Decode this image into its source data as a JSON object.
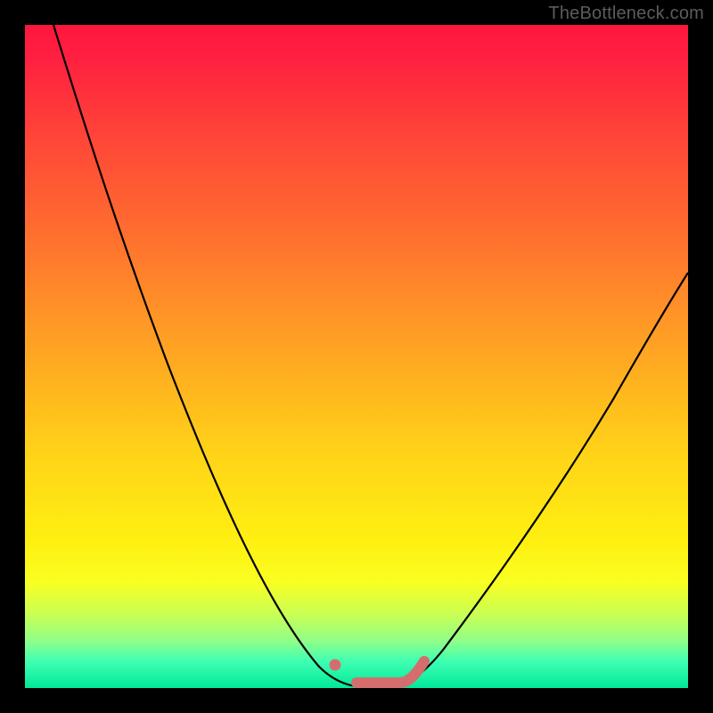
{
  "watermark": "TheBottleneck.com",
  "colors": {
    "background": "#000000",
    "marker": "#d46e6e",
    "curve": "#000000"
  },
  "chart_data": {
    "type": "line",
    "title": "",
    "xlabel": "",
    "ylabel": "",
    "xlim": [
      0,
      100
    ],
    "ylim": [
      0,
      100
    ],
    "series": [
      {
        "name": "bottleneck-curve",
        "x": [
          0,
          5,
          10,
          15,
          20,
          25,
          30,
          35,
          40,
          45,
          47,
          50,
          53,
          55,
          60,
          65,
          70,
          75,
          80,
          85,
          90,
          95,
          100
        ],
        "y": [
          100,
          90,
          80,
          69,
          58,
          47,
          36,
          25,
          14,
          4,
          1,
          0,
          1,
          4,
          12,
          21,
          30,
          38,
          45,
          52,
          58,
          64,
          70
        ]
      }
    ],
    "annotations": [
      {
        "name": "marker-dot",
        "x": 47,
        "y": 3
      },
      {
        "name": "marker-range",
        "x_start": 50,
        "x_end": 57,
        "y": 0,
        "end_y": 3
      }
    ]
  }
}
